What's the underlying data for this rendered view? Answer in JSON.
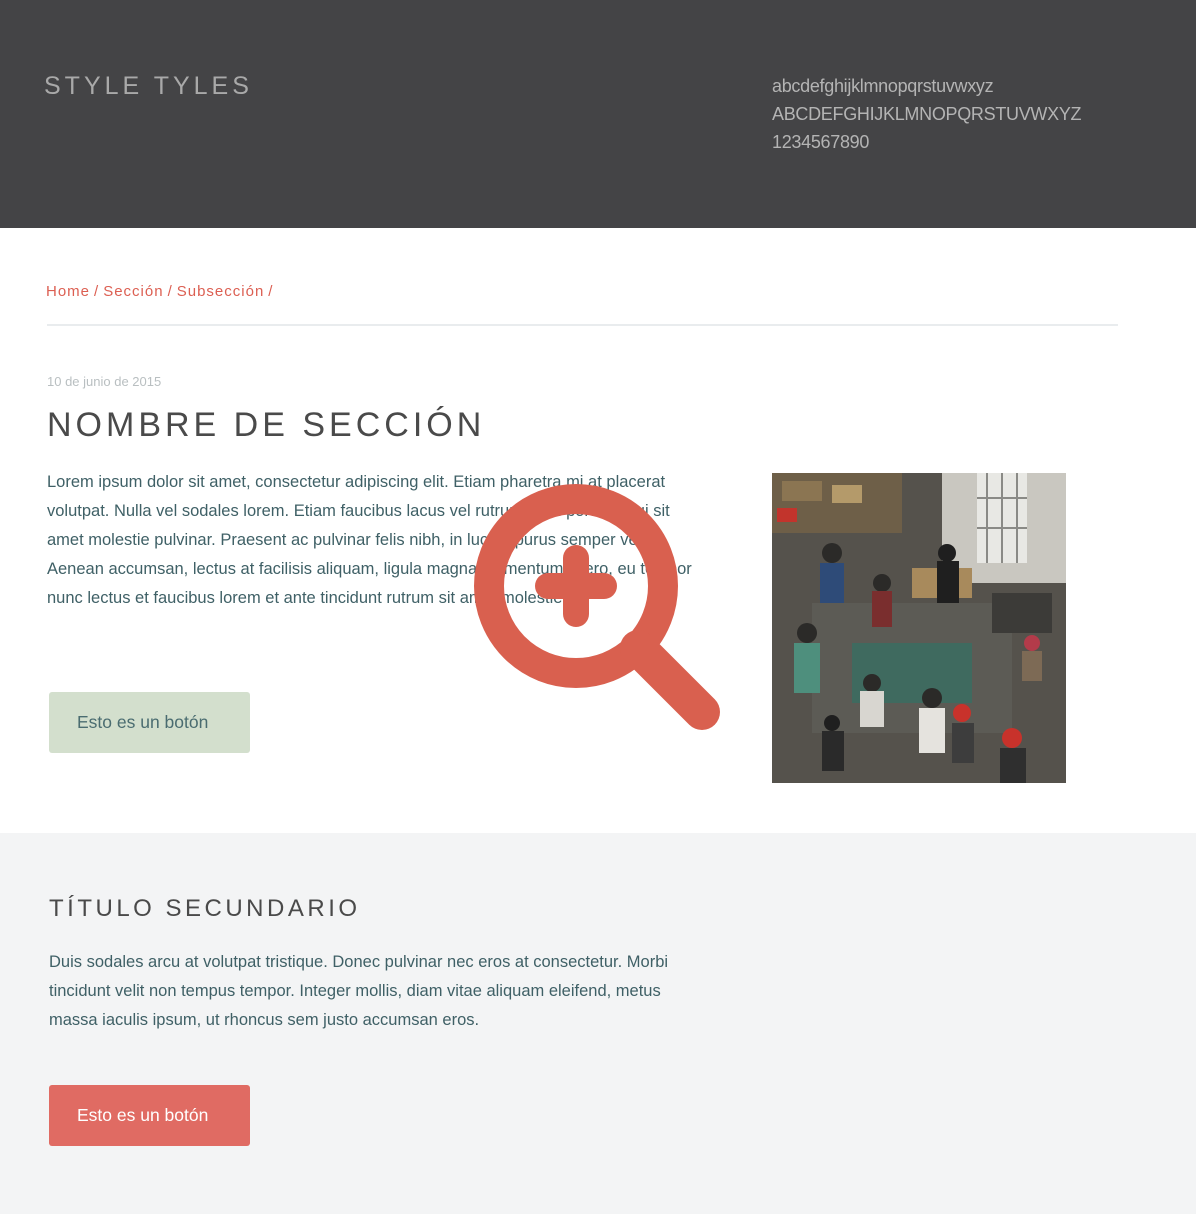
{
  "header": {
    "brand": "STYLE TYLES",
    "specimen": {
      "lowercase": "abcdefghijklmnopqrstuvwxyz",
      "uppercase": "ABCDEFGHIJKLMNOPQRSTUVWXYZ",
      "digits": "1234567890"
    }
  },
  "breadcrumb": {
    "items": [
      "Home",
      "Sección",
      "Subsección"
    ],
    "separator": "/"
  },
  "main": {
    "date": "10 de junio de 2015",
    "title": "NOMBRE DE SECCIÓN",
    "body": "Lorem ipsum dolor sit amet, consectetur adipiscing elit. Etiam pharetra mi at placerat volutpat. Nulla vel sodales lorem. Etiam faucibus lacus vel rutrum. Sed porttitor dui sit amet molestie pulvinar. Praesent ac pulvinar felis nibh, in luctus purus semper vel. Aenean accumsan, lectus at facilisis aliquam, ligula magna elementum libero, eu tempor nunc lectus et faucibus lorem et ante tincidunt rutrum sit amet molestie.",
    "button_label": "Esto es un botón"
  },
  "secondary": {
    "title": "TÍTULO SECUNDARIO",
    "body": "Duis sodales arcu at volutpat tristique. Donec pulvinar nec eros at consectetur. Morbi tincidunt velit non tempus tempor. Integer mollis, diam vitae aliquam eleifend, metus massa iaculis ipsum, ut rhoncus sem justo accumsan eros.",
    "button_label": "Esto es un botón"
  },
  "icons": {
    "zoom": "zoom-in-icon"
  },
  "colors": {
    "header_bg": "#444446",
    "accent": "#dc5f52",
    "text_teal": "#3f6066",
    "button_green": "#d3dfcd",
    "button_red": "#e06b63",
    "secondary_bg": "#f3f4f5"
  }
}
